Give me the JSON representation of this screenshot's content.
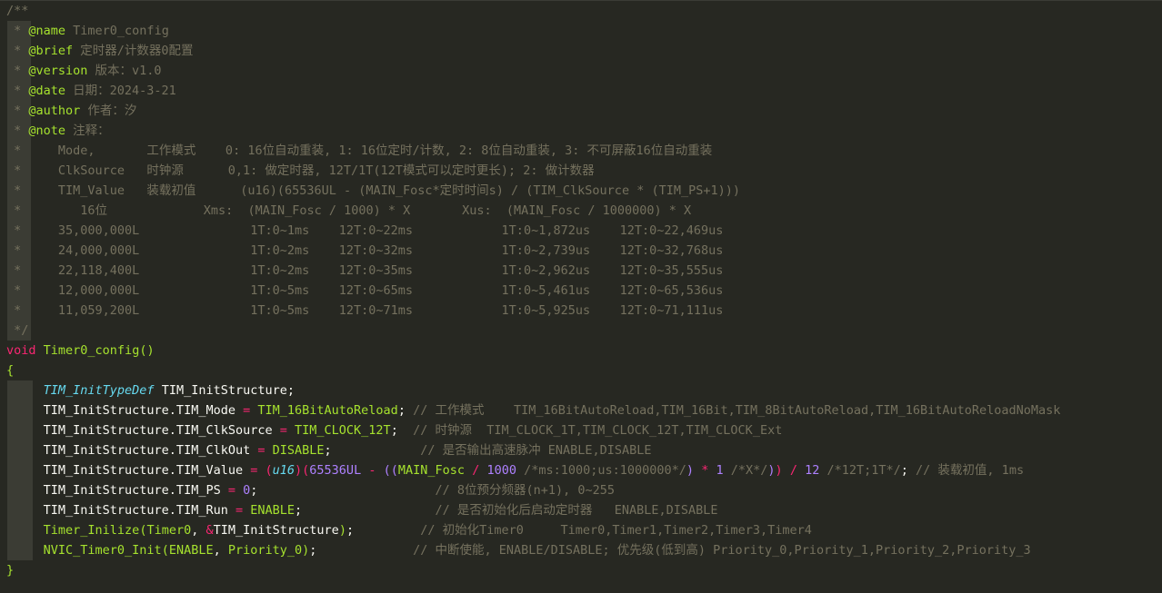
{
  "lines": [
    [
      {
        "t": "/**",
        "c": "c"
      }
    ],
    [
      {
        "t": " * ",
        "c": "c"
      },
      {
        "t": "@name",
        "c": "ct"
      },
      {
        "t": " Timer0_config",
        "c": "c"
      }
    ],
    [
      {
        "t": " * ",
        "c": "c"
      },
      {
        "t": "@brief",
        "c": "ct"
      },
      {
        "t": " 定时器/计数器0配置",
        "c": "c"
      }
    ],
    [
      {
        "t": " * ",
        "c": "c"
      },
      {
        "t": "@version",
        "c": "ct"
      },
      {
        "t": " 版本：v1.0",
        "c": "c"
      }
    ],
    [
      {
        "t": " * ",
        "c": "c"
      },
      {
        "t": "@date",
        "c": "ct"
      },
      {
        "t": " 日期：2024-3-21",
        "c": "c"
      }
    ],
    [
      {
        "t": " * ",
        "c": "c"
      },
      {
        "t": "@author",
        "c": "ct"
      },
      {
        "t": " 作者：汐",
        "c": "c"
      }
    ],
    [
      {
        "t": " * ",
        "c": "c"
      },
      {
        "t": "@note",
        "c": "ct"
      },
      {
        "t": " 注释：",
        "c": "c"
      }
    ],
    [
      {
        "t": " *     Mode,       工作模式    0: 16位自动重装, 1: 16位定时/计数, 2: 8位自动重装, 3: 不可屏蔽16位自动重装",
        "c": "c"
      }
    ],
    [
      {
        "t": " *     ClkSource   时钟源      0,1: 做定时器, 12T/1T(12T模式可以定时更长); 2: 做计数器",
        "c": "c"
      }
    ],
    [
      {
        "t": " *     TIM_Value   装载初值      (u16)(65536UL - (MAIN_Fosc*定时时间s) / (TIM_ClkSource * (TIM_PS+1)))",
        "c": "c"
      }
    ],
    [
      {
        "t": " *        16位             Xms:  (MAIN_Fosc / 1000) * X       Xus:  (MAIN_Fosc / 1000000) * X",
        "c": "c"
      }
    ],
    [
      {
        "t": " *     35,000,000L               1T:0~1ms    12T:0~22ms            1T:0~1,872us    12T:0~22,469us",
        "c": "c"
      }
    ],
    [
      {
        "t": " *     24,000,000L               1T:0~2ms    12T:0~32ms            1T:0~2,739us    12T:0~32,768us",
        "c": "c"
      }
    ],
    [
      {
        "t": " *     22,118,400L               1T:0~2ms    12T:0~35ms            1T:0~2,962us    12T:0~35,555us",
        "c": "c"
      }
    ],
    [
      {
        "t": " *     12,000,000L               1T:0~5ms    12T:0~65ms            1T:0~5,461us    12T:0~65,536us",
        "c": "c"
      }
    ],
    [
      {
        "t": " *     11,059,200L               1T:0~5ms    12T:0~71ms            1T:0~5,925us    12T:0~71,111us",
        "c": "c"
      }
    ],
    [
      {
        "t": " */",
        "c": "c"
      }
    ],
    [
      {
        "t": "void",
        "c": "kw"
      },
      {
        "t": " ",
        "c": "tx"
      },
      {
        "t": "Timer0_config",
        "c": "fn"
      },
      {
        "t": "()",
        "c": "br"
      }
    ],
    [
      {
        "t": "{",
        "c": "br"
      }
    ],
    [
      {
        "t": "     ",
        "c": "tx"
      },
      {
        "t": "TIM_InitTypeDef",
        "c": "ty"
      },
      {
        "t": " TIM_InitStructure;",
        "c": "tx"
      }
    ],
    [
      {
        "t": "     TIM_InitStructure.TIM_Mode ",
        "c": "tx"
      },
      {
        "t": "=",
        "c": "op"
      },
      {
        "t": " ",
        "c": "tx"
      },
      {
        "t": "TIM_16BitAutoReload",
        "c": "mc"
      },
      {
        "t": "; ",
        "c": "tx"
      },
      {
        "t": "// 工作模式    TIM_16BitAutoReload,TIM_16Bit,TIM_8BitAutoReload,TIM_16BitAutoReloadNoMask",
        "c": "c"
      }
    ],
    [
      {
        "t": "     TIM_InitStructure.TIM_ClkSource ",
        "c": "tx"
      },
      {
        "t": "=",
        "c": "op"
      },
      {
        "t": " ",
        "c": "tx"
      },
      {
        "t": "TIM_CLOCK_12T",
        "c": "mc"
      },
      {
        "t": ";  ",
        "c": "tx"
      },
      {
        "t": "// 时钟源  TIM_CLOCK_1T,TIM_CLOCK_12T,TIM_CLOCK_Ext",
        "c": "c"
      }
    ],
    [
      {
        "t": "     TIM_InitStructure.TIM_ClkOut ",
        "c": "tx"
      },
      {
        "t": "=",
        "c": "op"
      },
      {
        "t": " ",
        "c": "tx"
      },
      {
        "t": "DISABLE",
        "c": "mc"
      },
      {
        "t": ";            ",
        "c": "tx"
      },
      {
        "t": "// 是否输出高速脉冲 ENABLE,DISABLE",
        "c": "c"
      }
    ],
    [
      {
        "t": "     TIM_InitStructure.TIM_Value ",
        "c": "tx"
      },
      {
        "t": "=",
        "c": "op"
      },
      {
        "t": " ",
        "c": "tx"
      },
      {
        "t": "(",
        "c": "pk"
      },
      {
        "t": "u16",
        "c": "ty"
      },
      {
        "t": ")(",
        "c": "pk"
      },
      {
        "t": "65536UL",
        "c": "nm"
      },
      {
        "t": " ",
        "c": "tx"
      },
      {
        "t": "-",
        "c": "op"
      },
      {
        "t": " ",
        "c": "tx"
      },
      {
        "t": "((",
        "c": "pp"
      },
      {
        "t": "MAIN_Fosc",
        "c": "mc"
      },
      {
        "t": " ",
        "c": "tx"
      },
      {
        "t": "/",
        "c": "op"
      },
      {
        "t": " ",
        "c": "tx"
      },
      {
        "t": "1000",
        "c": "nm"
      },
      {
        "t": " /*ms:1000;us:1000000*/",
        "c": "c"
      },
      {
        "t": ")",
        "c": "pp"
      },
      {
        "t": " ",
        "c": "tx"
      },
      {
        "t": "*",
        "c": "op"
      },
      {
        "t": " ",
        "c": "tx"
      },
      {
        "t": "1",
        "c": "nm"
      },
      {
        "t": " /*X*/",
        "c": "c"
      },
      {
        "t": ")",
        "c": "pp"
      },
      {
        "t": ")",
        "c": "pk"
      },
      {
        "t": " ",
        "c": "tx"
      },
      {
        "t": "/",
        "c": "op"
      },
      {
        "t": " ",
        "c": "tx"
      },
      {
        "t": "12",
        "c": "nm"
      },
      {
        "t": " /*12T;1T*/",
        "c": "c"
      },
      {
        "t": "; ",
        "c": "tx"
      },
      {
        "t": "// 装载初值, 1ms",
        "c": "c"
      }
    ],
    [
      {
        "t": "     TIM_InitStructure.TIM_PS ",
        "c": "tx"
      },
      {
        "t": "=",
        "c": "op"
      },
      {
        "t": " ",
        "c": "tx"
      },
      {
        "t": "0",
        "c": "nm"
      },
      {
        "t": ";                        ",
        "c": "tx"
      },
      {
        "t": "// 8位预分频器(n+1), 0~255",
        "c": "c"
      }
    ],
    [
      {
        "t": "     TIM_InitStructure.TIM_Run ",
        "c": "tx"
      },
      {
        "t": "=",
        "c": "op"
      },
      {
        "t": " ",
        "c": "tx"
      },
      {
        "t": "ENABLE",
        "c": "mc"
      },
      {
        "t": ";                  ",
        "c": "tx"
      },
      {
        "t": "// 是否初始化后启动定时器   ENABLE,DISABLE",
        "c": "c"
      }
    ],
    [
      {
        "t": "     ",
        "c": "tx"
      },
      {
        "t": "Timer_Inilize",
        "c": "fn"
      },
      {
        "t": "(",
        "c": "br"
      },
      {
        "t": "Timer0",
        "c": "mc"
      },
      {
        "t": ", ",
        "c": "tx"
      },
      {
        "t": "&",
        "c": "op"
      },
      {
        "t": "TIM_InitStructure",
        "c": "tx"
      },
      {
        "t": ")",
        "c": "br"
      },
      {
        "t": ";         ",
        "c": "tx"
      },
      {
        "t": "// 初始化Timer0     Timer0,Timer1,Timer2,Timer3,Timer4",
        "c": "c"
      }
    ],
    [
      {
        "t": "     ",
        "c": "tx"
      },
      {
        "t": "NVIC_Timer0_Init",
        "c": "fn"
      },
      {
        "t": "(",
        "c": "br"
      },
      {
        "t": "ENABLE",
        "c": "mc"
      },
      {
        "t": ", ",
        "c": "tx"
      },
      {
        "t": "Priority_0",
        "c": "mc"
      },
      {
        "t": ")",
        "c": "br"
      },
      {
        "t": ";             ",
        "c": "tx"
      },
      {
        "t": "// 中断使能, ENABLE/DISABLE; 优先级(低到高) Priority_0,Priority_1,Priority_2,Priority_3",
        "c": "c"
      }
    ],
    [
      {
        "t": "}",
        "c": "br"
      }
    ]
  ],
  "colors": {
    "background": "#272822",
    "comment": "#75715e",
    "comment_tag": "#a6e22e",
    "keyword": "#f92672",
    "type": "#66d9ef",
    "function": "#a6e22e",
    "number": "#ae81ff",
    "text": "#f8f8f2",
    "indent_guide": "#3b3c34"
  }
}
